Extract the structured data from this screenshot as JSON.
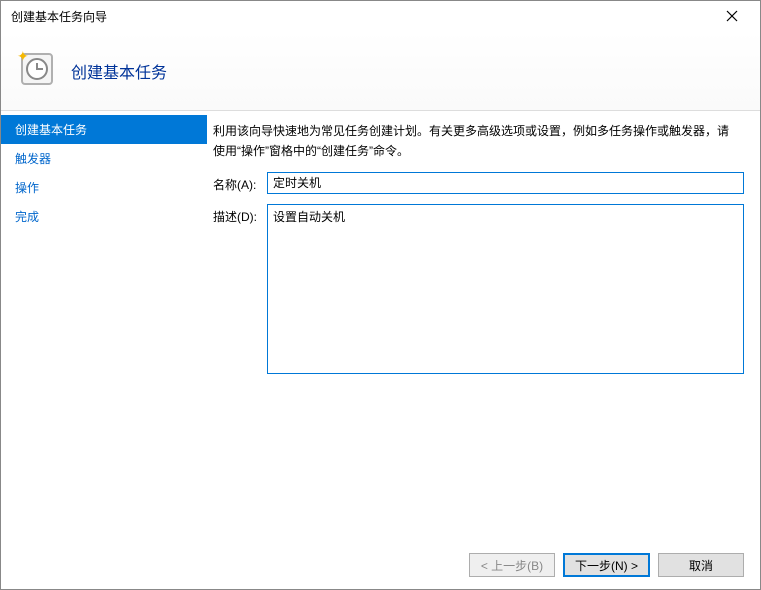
{
  "window": {
    "title": "创建基本任务向导"
  },
  "header": {
    "title": "创建基本任务"
  },
  "sidebar": {
    "items": [
      {
        "label": "创建基本任务",
        "active": true
      },
      {
        "label": "触发器",
        "active": false
      },
      {
        "label": "操作",
        "active": false
      },
      {
        "label": "完成",
        "active": false
      }
    ]
  },
  "content": {
    "help_text": "利用该向导快速地为常见任务创建计划。有关更多高级选项或设置，例如多任务操作或触发器，请使用“操作”窗格中的“创建任务”命令。",
    "name_label": "名称(A):",
    "name_value": "定时关机",
    "desc_label": "描述(D):",
    "desc_value": "设置自动关机"
  },
  "footer": {
    "back": "< 上一步(B)",
    "next": "下一步(N) >",
    "cancel": "取消"
  }
}
